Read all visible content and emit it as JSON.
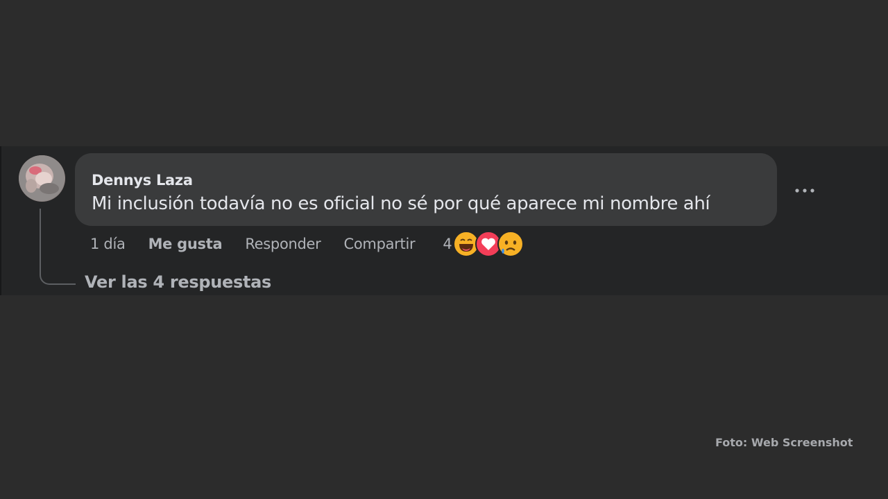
{
  "comment": {
    "author": "Dennys Laza",
    "text": "Mi inclusión todavía no es oficial no sé por qué aparece mi nombre ahí",
    "avatar_icon": "user-avatar",
    "more_icon": "more-options-icon"
  },
  "actions": {
    "time": "1 día",
    "like_label": "Me gusta",
    "reply_label": "Responder",
    "share_label": "Compartir",
    "reaction_count": "4",
    "reactions": [
      "haha-reaction-icon",
      "love-reaction-icon",
      "sad-reaction-icon"
    ]
  },
  "replies": {
    "label": "Ver las 4 respuestas"
  },
  "caption": "Foto: Web Screenshot",
  "colors": {
    "page_background": "#2c2c2c",
    "panel_background": "#242526",
    "bubble_background": "#3a3b3c",
    "primary_text": "#e4e6eb",
    "secondary_text": "#b0b3b8",
    "love_red": "#f33e58",
    "emoji_yellow": "#f7b125"
  }
}
